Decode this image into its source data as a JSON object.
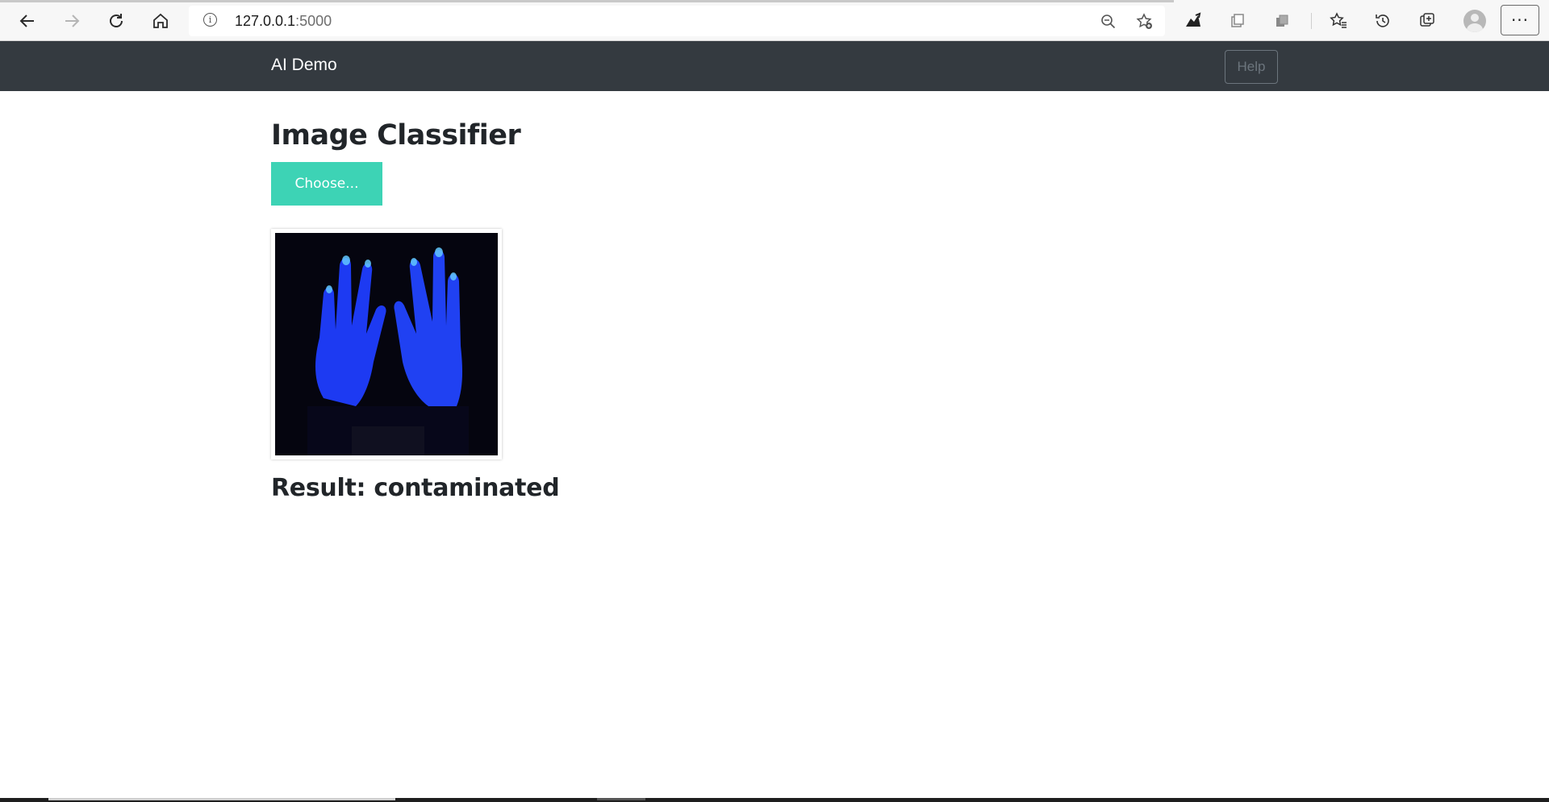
{
  "browser": {
    "url_host": "127.0.0.1",
    "url_port": ":5000",
    "more_label": "···"
  },
  "navbar": {
    "brand": "AI Demo",
    "help_label": "Help"
  },
  "main": {
    "title": "Image Classifier",
    "choose_label": "Choose...",
    "result_text": "Result: contaminated"
  },
  "colors": {
    "navbar_bg": "#343a40",
    "choose_button": "#3dd3b5",
    "help_outline": "#6c757d"
  }
}
